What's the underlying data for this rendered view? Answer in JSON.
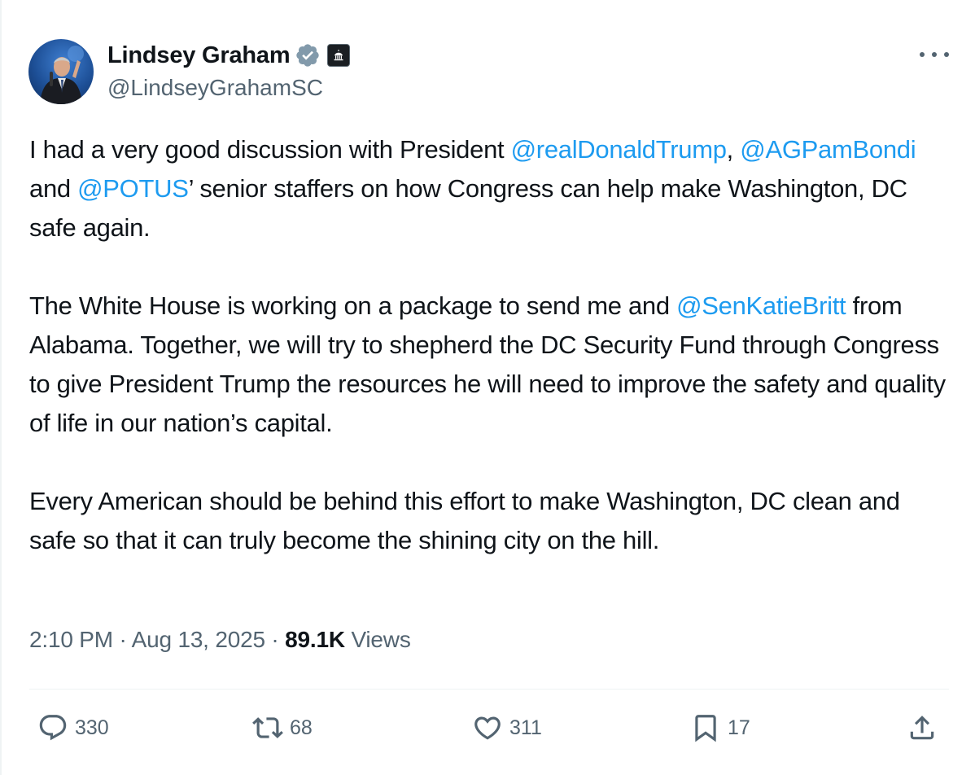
{
  "author": {
    "name": "Lindsey Graham",
    "handle": "@LindseyGrahamSC",
    "avatar_icon": "profile-photo",
    "verified_badge_color": "#829aab",
    "government_badge_icon": "capitol-building-icon"
  },
  "tweet": {
    "paragraphs": [
      [
        {
          "text": "I had a very good discussion with President ",
          "mention": false
        },
        {
          "text": "@realDonaldTrump",
          "mention": true
        },
        {
          "text": ", ",
          "mention": false
        },
        {
          "text": "@AGPamBondi",
          "mention": true
        },
        {
          "text": " and ",
          "mention": false
        },
        {
          "text": "@POTUS",
          "mention": true
        },
        {
          "text": "’ senior staffers on how Congress can help make Washington, DC safe again.",
          "mention": false
        }
      ],
      [
        {
          "text": "The White House is working on a package to send me and ",
          "mention": false
        },
        {
          "text": "@SenKatieBritt",
          "mention": true
        },
        {
          "text": " from Alabama. Together, we will try to shepherd the DC Security Fund through Congress to give President Trump the resources he will need to improve the safety and quality of life in our nation’s capital.",
          "mention": false
        }
      ],
      [
        {
          "text": "Every American should be behind this effort to make Washington, DC clean and safe so that it can truly become the shining city on the hill.",
          "mention": false
        }
      ]
    ]
  },
  "meta": {
    "time": "2:10 PM",
    "separator": " · ",
    "date": "Aug 13, 2025",
    "views_count": "89.1K",
    "views_label": " Views"
  },
  "actions": {
    "reply_count": "330",
    "retweet_count": "68",
    "like_count": "311",
    "bookmark_count": "17"
  },
  "colors": {
    "mention": "#1d9bf0",
    "secondary_text": "#536471",
    "primary_text": "#0f1419"
  }
}
